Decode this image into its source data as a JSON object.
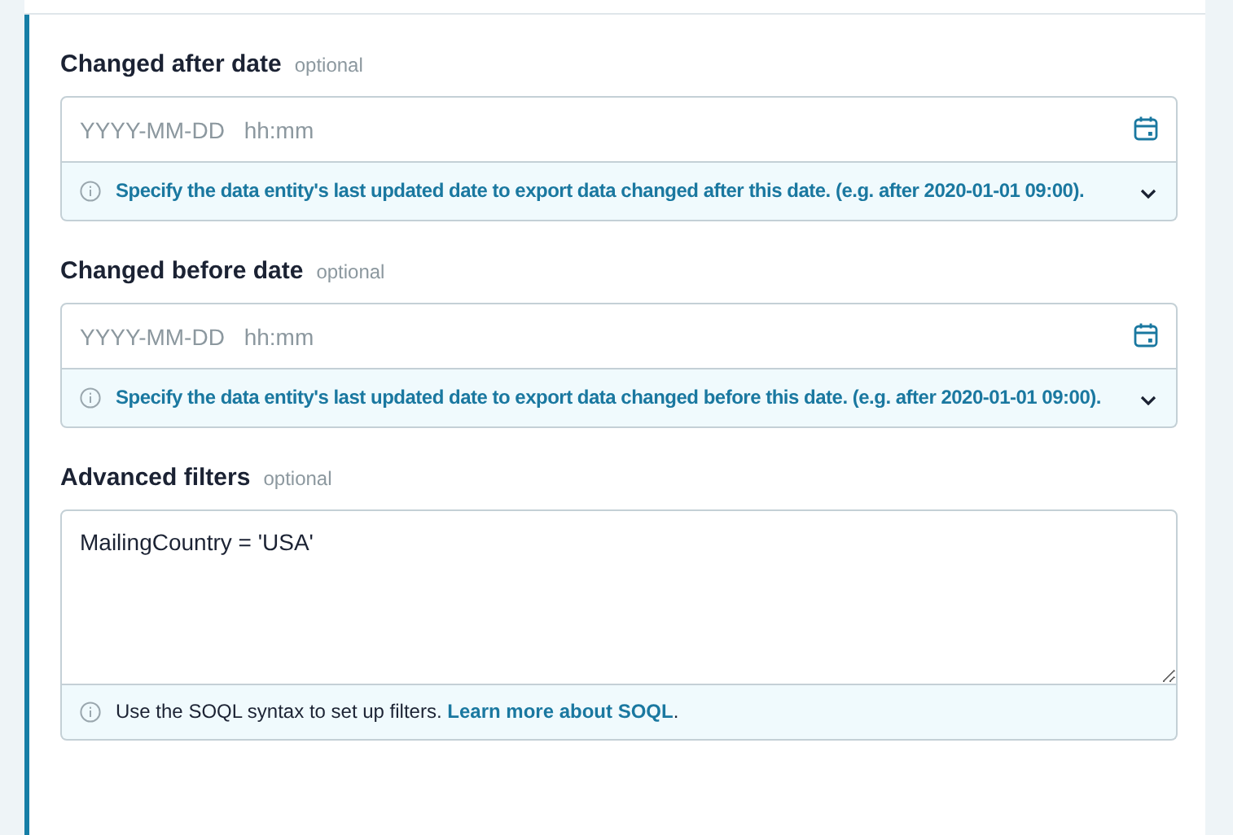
{
  "fields": [
    {
      "kind": "date",
      "label": "Changed after date",
      "tag": "optional",
      "placeholder": "YYYY-MM-DD hh:mm",
      "hint": {
        "text": "Specify the data entity's last updated date to export data changed after this date. (e.g. after 2020-01-01 09:00)."
      }
    },
    {
      "kind": "date",
      "label": "Changed before date",
      "tag": "optional",
      "placeholder": "YYYY-MM-DD hh:mm",
      "hint": {
        "text": "Specify the data entity's last updated date to export data changed before this date. (e.g. after 2020-01-01 09:00)."
      }
    },
    {
      "kind": "textarea",
      "label": "Advanced filters",
      "tag": "optional",
      "value": "MailingCountry = 'USA'",
      "hint": {
        "text": "Use the SOQL syntax to set up filters.",
        "link": "Learn more about SOQL",
        "suffix": "."
      }
    }
  ]
}
